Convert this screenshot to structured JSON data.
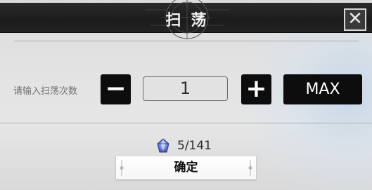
{
  "dialog": {
    "title": "扫荡",
    "close_icon": "close-icon"
  },
  "sweep": {
    "prompt": "请输入扫荡次数",
    "decrement_label": "−",
    "count_value": "1",
    "increment_label": "+",
    "max_label": "MAX"
  },
  "cost": {
    "icon": "crystal-gem-icon",
    "text": "5/141"
  },
  "confirm": {
    "label": "确定"
  },
  "colors": {
    "titlebar": "#1b1b1b",
    "button": "#0d0d0d",
    "background": "#e2e2e2",
    "gem": "#6b83d8"
  }
}
